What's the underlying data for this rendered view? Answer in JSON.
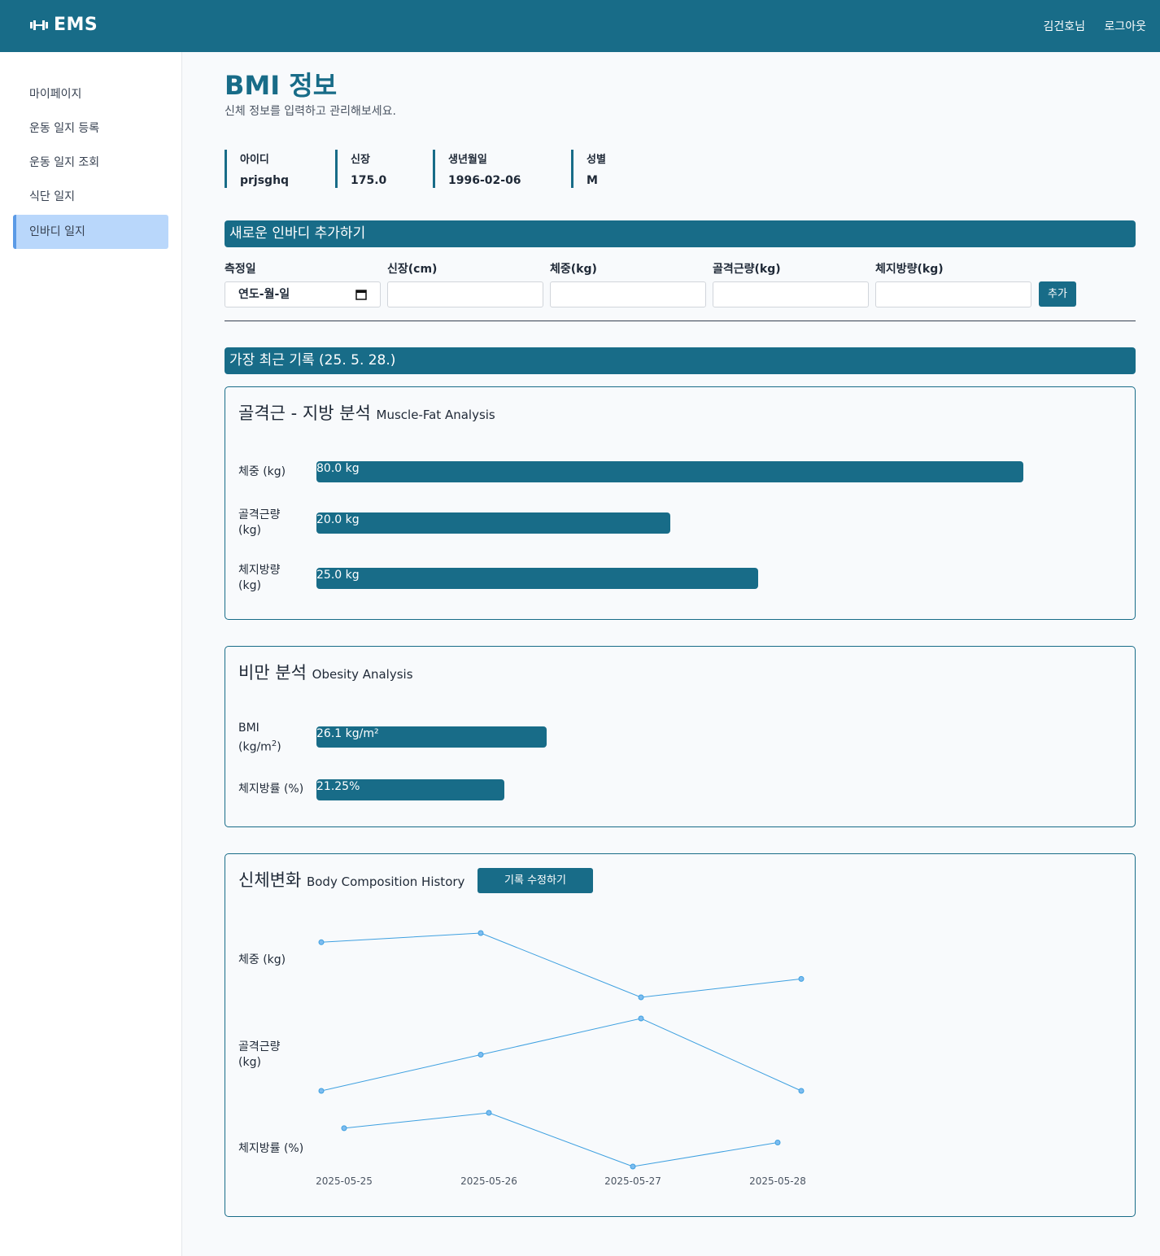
{
  "topbar": {
    "brand": "EMS",
    "user": "김건호님",
    "logout": "로그아웃"
  },
  "sidebar": {
    "items": [
      {
        "label": "마이페이지"
      },
      {
        "label": "운동 일지 등록"
      },
      {
        "label": "운동 일지 조회"
      },
      {
        "label": "식단 일지"
      },
      {
        "label": "인바디 일지"
      }
    ]
  },
  "page": {
    "title": "BMI 정보",
    "subtitle": "신체 정보를 입력하고 관리해보세요."
  },
  "profile": {
    "id_label": "아이디",
    "id_value": "prjsghq",
    "height_label": "신장",
    "height_value": "175.0",
    "birth_label": "생년월일",
    "birth_value": "1996-02-06",
    "gender_label": "성별",
    "gender_value": "M"
  },
  "add_form": {
    "title": "새로운 인바디 추가하기",
    "date_label": "측정일",
    "date_placeholder": "연도-월-일",
    "height_label": "신장(cm)",
    "weight_label": "체중(kg)",
    "muscle_label": "골격근량(kg)",
    "fat_label": "체지방량(kg)",
    "submit": "추가"
  },
  "latest": {
    "title": "가장 최근 기록 (25. 5. 28.)"
  },
  "muscle_fat": {
    "title": "골격근 - 지방 분석",
    "title_en": "Muscle-Fat Analysis",
    "rows": [
      {
        "label": "체중 (kg)",
        "value": "80.0 kg",
        "fill": 0.776
      },
      {
        "label": "골격근량 (kg)",
        "value": "20.0 kg",
        "fill": 0.388
      },
      {
        "label": "체지방량 (kg)",
        "value": "25.0 kg",
        "fill": 0.485
      }
    ]
  },
  "obesity": {
    "title": "비만 분석",
    "title_en": "Obesity Analysis",
    "bmi_label_1": "BMI",
    "bmi_label_2": "(kg/m",
    "bmi_sup": "2",
    "bmi_label_3": ")",
    "bmi_value": "26.1 kg/m²",
    "bmi_fill": 0.253,
    "fat_label": "체지방률 (%)",
    "fat_value": "21.25%",
    "fat_fill": 0.206
  },
  "history": {
    "title": "신체변화",
    "title_en": "Body Composition History",
    "edit_button": "기록 수정하기",
    "row_labels": [
      "체중 (kg)",
      "골격근량 (kg)",
      "체지방률 (%)"
    ]
  },
  "colors": {
    "primary": "#186c88",
    "active_bg": "#b9d7fb",
    "line": "#3ea0e0"
  },
  "chart_data": {
    "type": "line",
    "x": [
      "2025-05-25",
      "2025-05-26",
      "2025-05-27",
      "2025-05-28"
    ],
    "series": [
      {
        "name": "체중 (kg)",
        "values": [
          80.5,
          81.0,
          77.5,
          78.5
        ]
      },
      {
        "name": "골격근량 (kg)",
        "values": [
          18.0,
          20.0,
          22.0,
          18.0
        ]
      },
      {
        "name": "체지방률 (%)",
        "values": [
          22.0,
          22.8,
          20.0,
          21.25
        ]
      }
    ]
  }
}
